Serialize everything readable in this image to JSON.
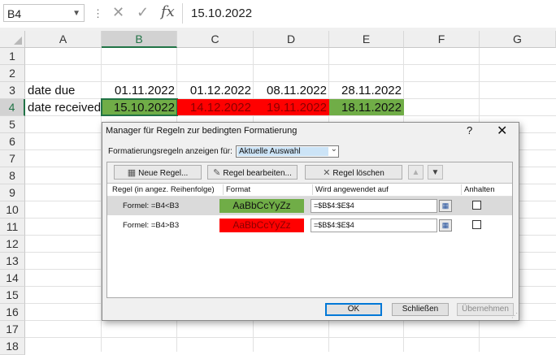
{
  "formula_bar": {
    "name_box": "B4",
    "formula": "15.10.2022",
    "cancel_glyph": "✕",
    "enter_glyph": "✓",
    "fx_glyph": "fx"
  },
  "columns": [
    "A",
    "B",
    "C",
    "D",
    "E",
    "F",
    "G"
  ],
  "rows": [
    "1",
    "2",
    "3",
    "4",
    "5",
    "6",
    "7",
    "8",
    "9",
    "10",
    "11",
    "12",
    "13",
    "14",
    "15",
    "16",
    "17",
    "18"
  ],
  "cells": {
    "A3": "date due",
    "B3": "01.11.2022",
    "C3": "01.12.2022",
    "D3": "08.11.2022",
    "E3": "28.11.2022",
    "A4": "date received",
    "B4": "15.10.2022",
    "C4": "14.12.2022",
    "D4": "19.11.2022",
    "E4": "18.11.2022"
  },
  "colors": {
    "green_fill": "#70ad47",
    "red_fill": "#ff0000",
    "excel_accent": "#217346"
  },
  "dialog": {
    "title": "Manager für Regeln zur bedingten Formatierung",
    "help": "?",
    "close": "✕",
    "show_rules_label": "Formatierungsregeln anzeigen für:",
    "show_rules_value": "Aktuelle Auswahl",
    "toolbar": {
      "new_rule": "Neue Regel...",
      "edit_rule": "Regel bearbeiten...",
      "delete_rule": "Regel löschen",
      "move_up": "▲",
      "move_down": "▼"
    },
    "headers": {
      "rule": "Regel (in angez. Reihenfolge)",
      "format": "Format",
      "applies_to": "Wird angewendet auf",
      "stop": "Anhalten"
    },
    "rules": [
      {
        "formula": "Formel: =B4<B3",
        "preview": "AaBbCcYyZz",
        "applies_to": "=$B$4:$E$4",
        "stop_if_true": false,
        "selected": true
      },
      {
        "formula": "Formel: =B4>B3",
        "preview": "AaBbCcYyZz",
        "applies_to": "=$B$4:$E$4",
        "stop_if_true": false,
        "selected": false
      }
    ],
    "buttons": {
      "ok": "OK",
      "close": "Schließen",
      "apply": "Übernehmen"
    }
  }
}
